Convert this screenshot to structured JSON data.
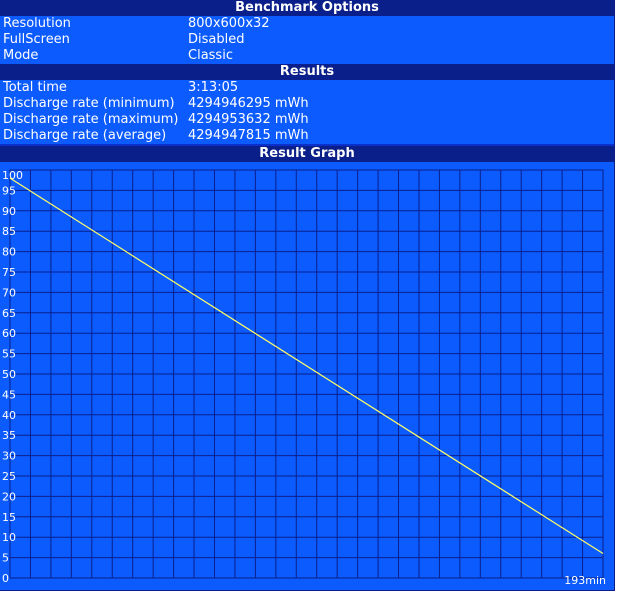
{
  "benchmark_options": {
    "title": "Benchmark Options",
    "rows": [
      {
        "label": "Resolution",
        "value": "800x600x32"
      },
      {
        "label": "FullScreen",
        "value": "Disabled"
      },
      {
        "label": "Mode",
        "value": "Classic"
      }
    ]
  },
  "results": {
    "title": "Results",
    "rows": [
      {
        "label": "Total time",
        "value": "3:13:05"
      },
      {
        "label": "Discharge rate (minimum)",
        "value": "4294946295 mWh"
      },
      {
        "label": "Discharge rate (maximum)",
        "value": "4294953632 mWh"
      },
      {
        "label": "Discharge rate (average)",
        "value": "4294947815 mWh"
      }
    ]
  },
  "graph": {
    "title": "Result Graph"
  },
  "colors": {
    "panel": "#0b5bff",
    "header": "#0a1f8a",
    "grid": "#0a1f8a",
    "line": "#ffff66",
    "text": "#ffffff"
  },
  "chart_data": {
    "type": "line",
    "title": "Result Graph",
    "xlabel": "",
    "ylabel": "",
    "ylim": [
      0,
      100
    ],
    "xlim": [
      0,
      193
    ],
    "yticks": [
      0,
      5,
      10,
      15,
      20,
      25,
      30,
      35,
      40,
      45,
      50,
      55,
      60,
      65,
      70,
      75,
      80,
      85,
      90,
      95,
      100
    ],
    "x_end_label": "193min",
    "grid": true,
    "series": [
      {
        "x": [
          0,
          193
        ],
        "y": [
          98,
          6
        ]
      }
    ]
  }
}
